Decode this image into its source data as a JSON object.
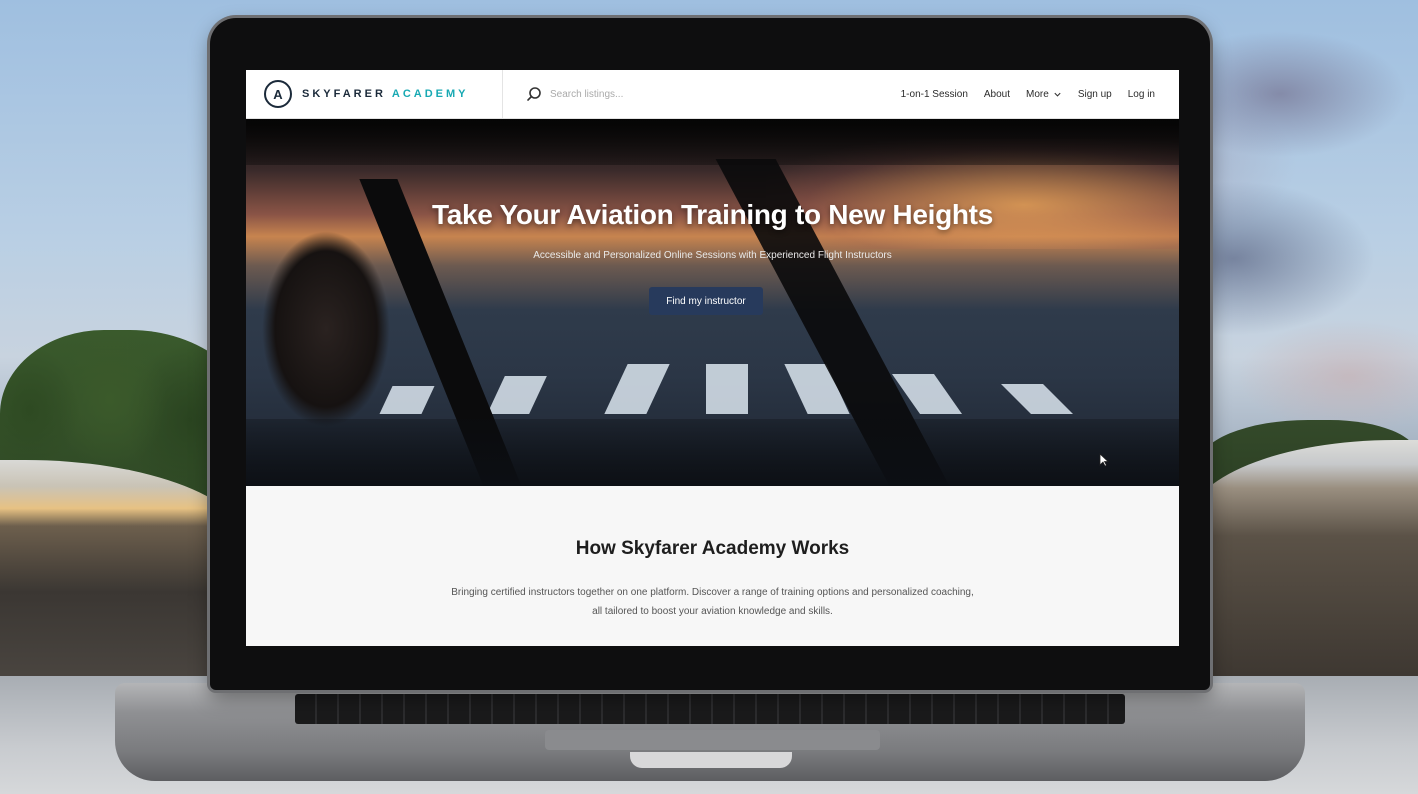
{
  "header": {
    "brand_mark_glyph": "A",
    "brand_word1": "SKYFARER",
    "brand_word2": "ACADEMY",
    "search_placeholder": "Search listings...",
    "nav": {
      "session": "1-on-1 Session",
      "about": "About",
      "more": "More",
      "signup": "Sign up",
      "login": "Log in"
    }
  },
  "hero": {
    "title": "Take Your Aviation Training to New Heights",
    "subtitle": "Accessible and Personalized Online Sessions with Experienced Flight Instructors",
    "cta": "Find my instructor"
  },
  "how": {
    "title": "How Skyfarer Academy Works",
    "text": "Bringing certified instructors together on one platform. Discover a range of training options and personalized coaching, all tailored to boost your aviation knowledge and skills."
  },
  "colors": {
    "brand_dark": "#1b2a3a",
    "brand_accent": "#18a9b3",
    "cta_bg": "#273a5c"
  },
  "icons": [
    "search-icon",
    "chevron-down-icon",
    "brand-logo-icon",
    "mouse-cursor-icon"
  ]
}
